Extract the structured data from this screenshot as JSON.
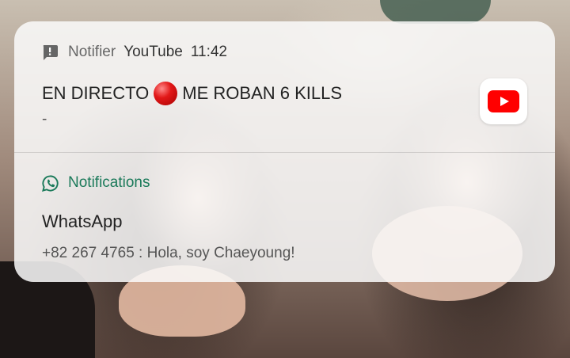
{
  "notifications": [
    {
      "app_label": "Notifier",
      "sub_text": "YouTube",
      "time": "11:42",
      "title_before": "EN DIRECTO",
      "title_after": "ME ROBAN 6 KILLS",
      "body": "-",
      "header_icon": "notifier-chat-icon",
      "large_icon": "youtube-icon"
    },
    {
      "app_label": "Notifications",
      "title": "WhatsApp",
      "body": "+82 267 4765 : Hola, soy Chaeyoung!",
      "header_icon": "whatsapp-icon"
    }
  ],
  "colors": {
    "accent_green": "#1b7a5a",
    "youtube_red": "#ff0000",
    "card_bg": "#fafafa"
  }
}
